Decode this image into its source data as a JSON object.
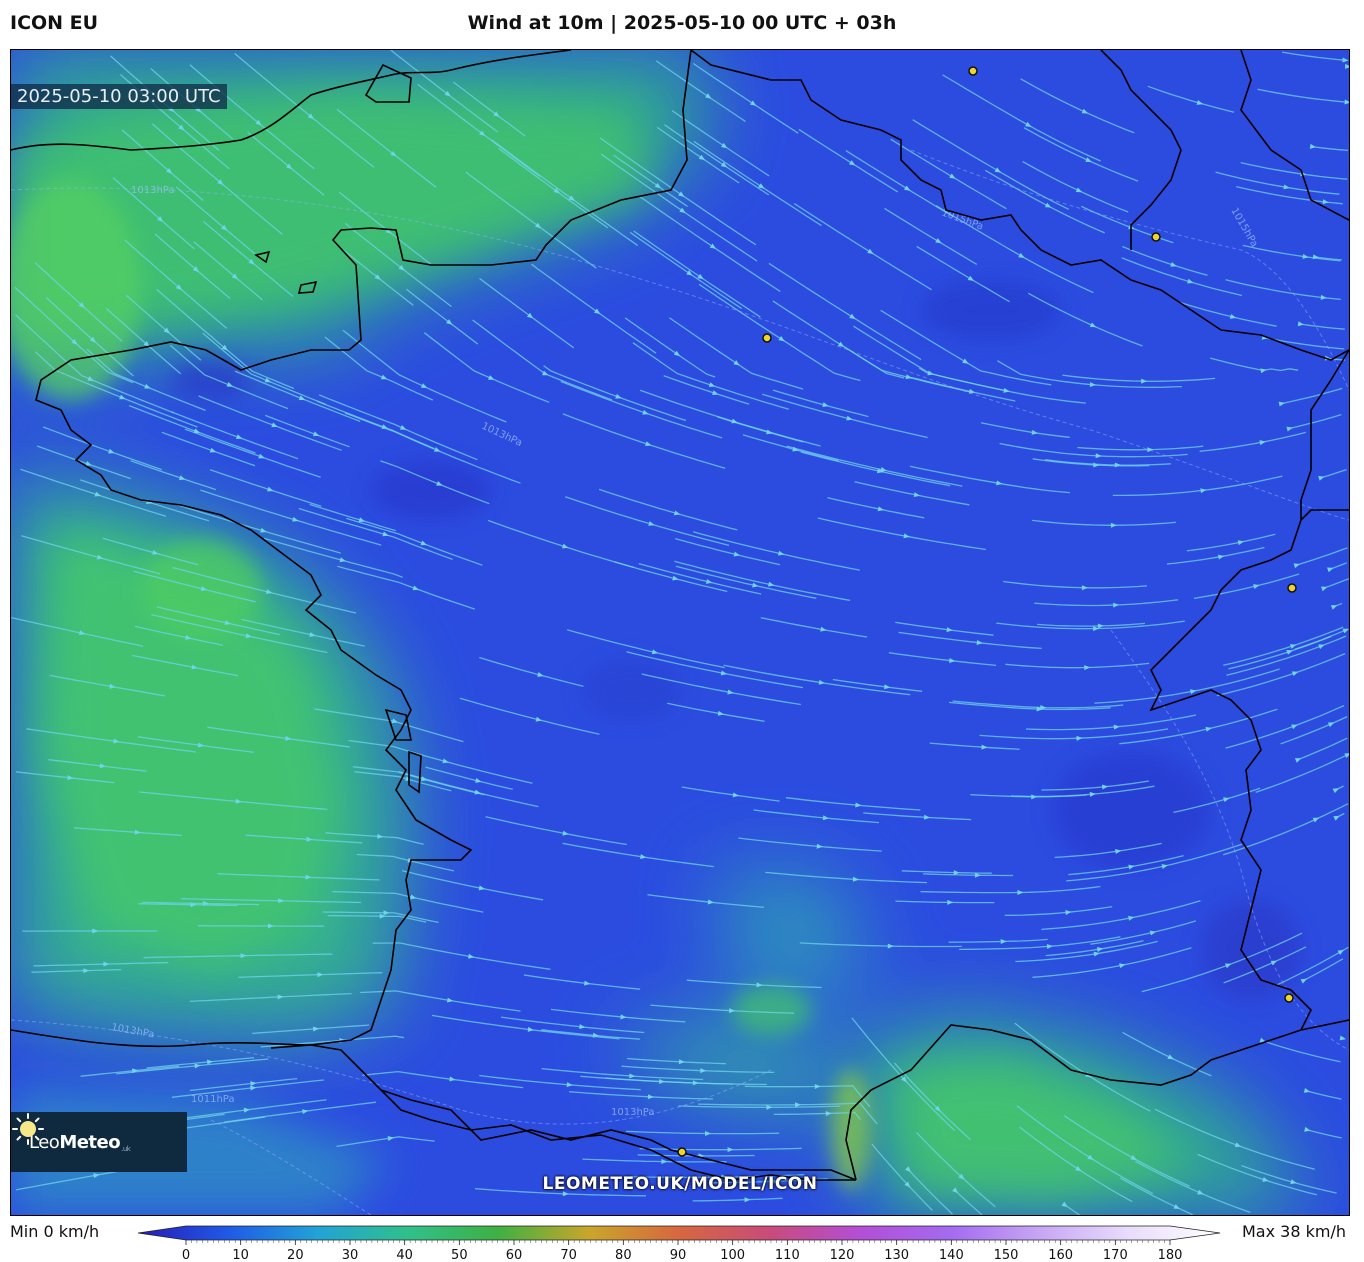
{
  "header": {
    "model": "ICON EU",
    "title": "Wind at 10m | 2025-05-10 00 UTC + 03h"
  },
  "map": {
    "timestamp": "2025-05-10 03:00 UTC",
    "watermark": "LEOMETEO.UK/MODEL/ICON",
    "pressure_labels": [
      "1013hPa",
      "1015hPa",
      "1013hPa",
      "1015hPa",
      "1011hPa",
      "1013hPa",
      "1013hPa"
    ],
    "colors": {
      "calm": "#2c4ce0",
      "moderate": "#2aa6c9",
      "breezy": "#3cc27a",
      "streamline": "#6fd3ea",
      "coastline": "#000000",
      "city_marker": "#f1d430"
    }
  },
  "logo": {
    "name_light": "Leo",
    "name_bold": "Meteo",
    "suffix": ".uk"
  },
  "colorbar": {
    "min_label": "Min 0 km/h",
    "max_label": "Max 38 km/h",
    "ticks": [
      "0",
      "10",
      "20",
      "30",
      "40",
      "50",
      "60",
      "70",
      "80",
      "90",
      "100",
      "110",
      "120",
      "130",
      "140",
      "150",
      "160",
      "170",
      "180"
    ],
    "stops": [
      "#2a1ab8",
      "#1f5ae6",
      "#22a3d6",
      "#2fc08a",
      "#3fb043",
      "#c9a62a",
      "#d7673f",
      "#c94b7a",
      "#b34ed6",
      "#a46af0",
      "#c6a6f4",
      "#e9ddfb",
      "#ffffff"
    ]
  }
}
